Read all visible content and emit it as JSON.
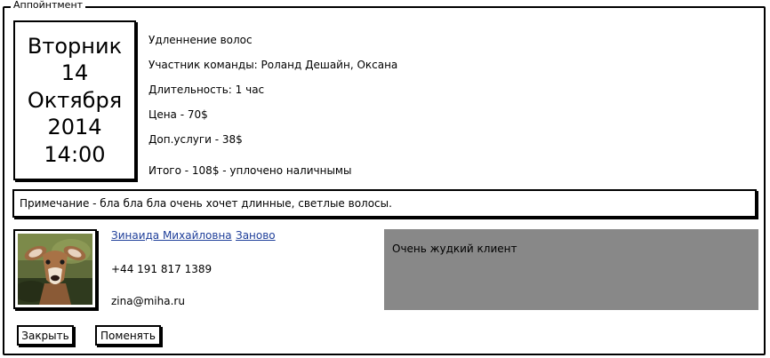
{
  "window": {
    "legend": "Аппойнтмент"
  },
  "appointment": {
    "date": {
      "weekday": "Вторник",
      "day": "14",
      "month": "Октября",
      "year": "2014",
      "time": "14:00"
    },
    "service": "Удленнение волос",
    "team_member": "Участник команды: Роланд Дешайн, Оксана",
    "duration": "Длительность: 1 час",
    "price": "Цена - 70$",
    "extras": "Доп.услуги - 38$",
    "total": "Итого - 108$ - уплочено наличнымы",
    "note": "Примечание - бла бла бла очень хочет длинные, светлые волосы."
  },
  "client": {
    "name_link": "Зинаида Михайловна",
    "repeat_link": "Заново",
    "phone": "+44 191 817 1389",
    "email": "zina@miha.ru",
    "comment": "Очень жудкий клиент"
  },
  "buttons": {
    "close": "Закрыть",
    "change": "Поменять"
  },
  "colors": {
    "link": "#1f3f9a",
    "comment_bg": "#888888",
    "border": "#000000"
  }
}
